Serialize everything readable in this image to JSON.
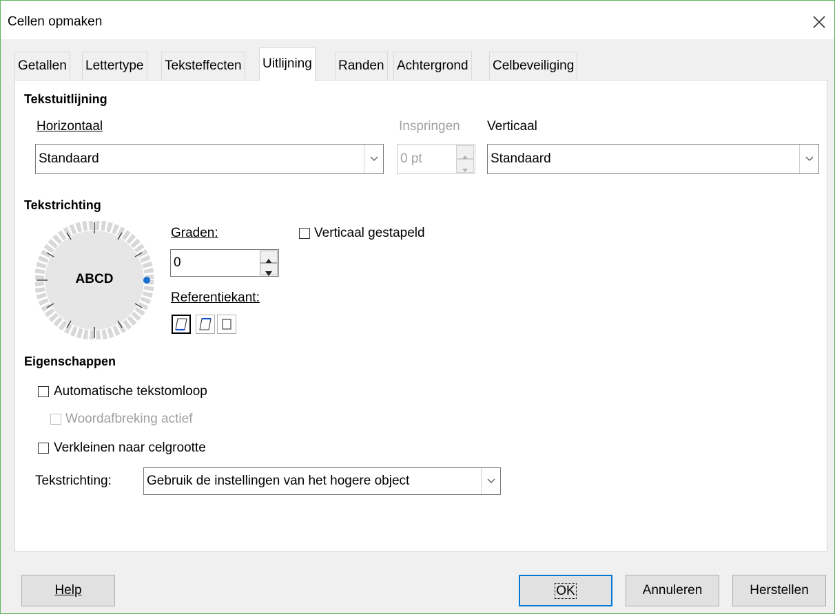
{
  "window": {
    "title": "Cellen opmaken"
  },
  "tabs": [
    {
      "label": "Getallen"
    },
    {
      "label": "Lettertype"
    },
    {
      "label": "Teksteffecten"
    },
    {
      "label": "Uitlijning"
    },
    {
      "label": "Randen"
    },
    {
      "label": "Achtergrond"
    },
    {
      "label": "Celbeveiliging"
    }
  ],
  "active_tab": "Uitlijning",
  "text_alignment": {
    "heading": "Tekstuitlijning",
    "horizontal_label": "Horizontaal",
    "horizontal_value": "Standaard",
    "indent_label": "Inspringen",
    "indent_value": "0 pt",
    "vertical_label": "Verticaal",
    "vertical_value": "Standaard"
  },
  "text_orientation": {
    "heading": "Tekstrichting",
    "dial_text": "ABCD",
    "degrees_label": "Graden:",
    "degrees_value": "0",
    "reference_edge_label": "Referentiekant:",
    "stacked_label": "Verticaal gestapeld",
    "stacked_checked": false
  },
  "properties": {
    "heading": "Eigenschappen",
    "wrap_label": "Automatische tekstomloop",
    "wrap_checked": false,
    "hyphenation_label": "Woordafbreking actief",
    "hyphenation_checked": false,
    "shrink_label": "Verkleinen naar celgrootte",
    "shrink_checked": false,
    "direction_label": "Tekstrichting:",
    "direction_value": "Gebruik de instellingen van het hogere object"
  },
  "buttons": {
    "help": "Help",
    "ok": "OK",
    "cancel": "Annuleren",
    "reset": "Herstellen"
  },
  "colors": {
    "accent": "#0078d7",
    "dial_dot": "#1a6fd1"
  }
}
